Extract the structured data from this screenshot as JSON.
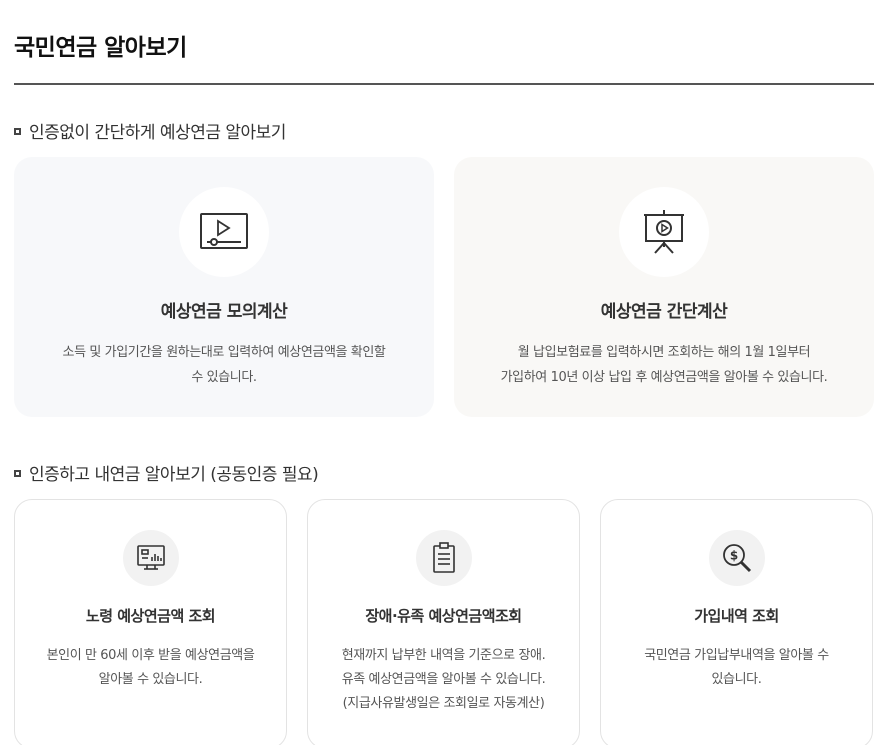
{
  "page": {
    "title": "국민연금 알아보기"
  },
  "section1": {
    "heading": "인증없이 간단하게 예상연금 알아보기",
    "cards": [
      {
        "icon": "video-play-icon",
        "title": "예상연금 모의계산",
        "desc_lines": [
          "소득 및 가입기간을 원하는대로 입력하여 예상연금액을 확인할",
          "수 있습니다."
        ]
      },
      {
        "icon": "presentation-board-icon",
        "title": "예상연금 간단계산",
        "desc_lines": [
          "월 납입보험료를 입력하시면 조회하는 해의 1월 1일부터",
          "가입하여 10년 이상 납입 후 예상연금액을 알아볼 수 있습니다."
        ]
      }
    ]
  },
  "section2": {
    "heading": "인증하고 내연금 알아보기 (공동인증 필요)",
    "cards": [
      {
        "icon": "monitor-chart-icon",
        "title": "노령 예상연금액 조회",
        "desc_lines": [
          "본인이 만 60세 이후 받을 예상연금액을",
          "알아볼 수 있습니다."
        ]
      },
      {
        "icon": "clipboard-icon",
        "title": "장애·유족 예상연금액조회",
        "desc_lines": [
          "현재까지 납부한 내역을 기준으로 장애.",
          "유족 예상연금액을 알아볼 수 있습니다.",
          "(지급사유발생일은 조회일로 자동계산)"
        ]
      },
      {
        "icon": "money-search-icon",
        "title": "가입내역 조회",
        "desc_lines": [
          "국민연금 가입납부내역을 알아볼 수",
          "있습니다."
        ]
      }
    ]
  }
}
